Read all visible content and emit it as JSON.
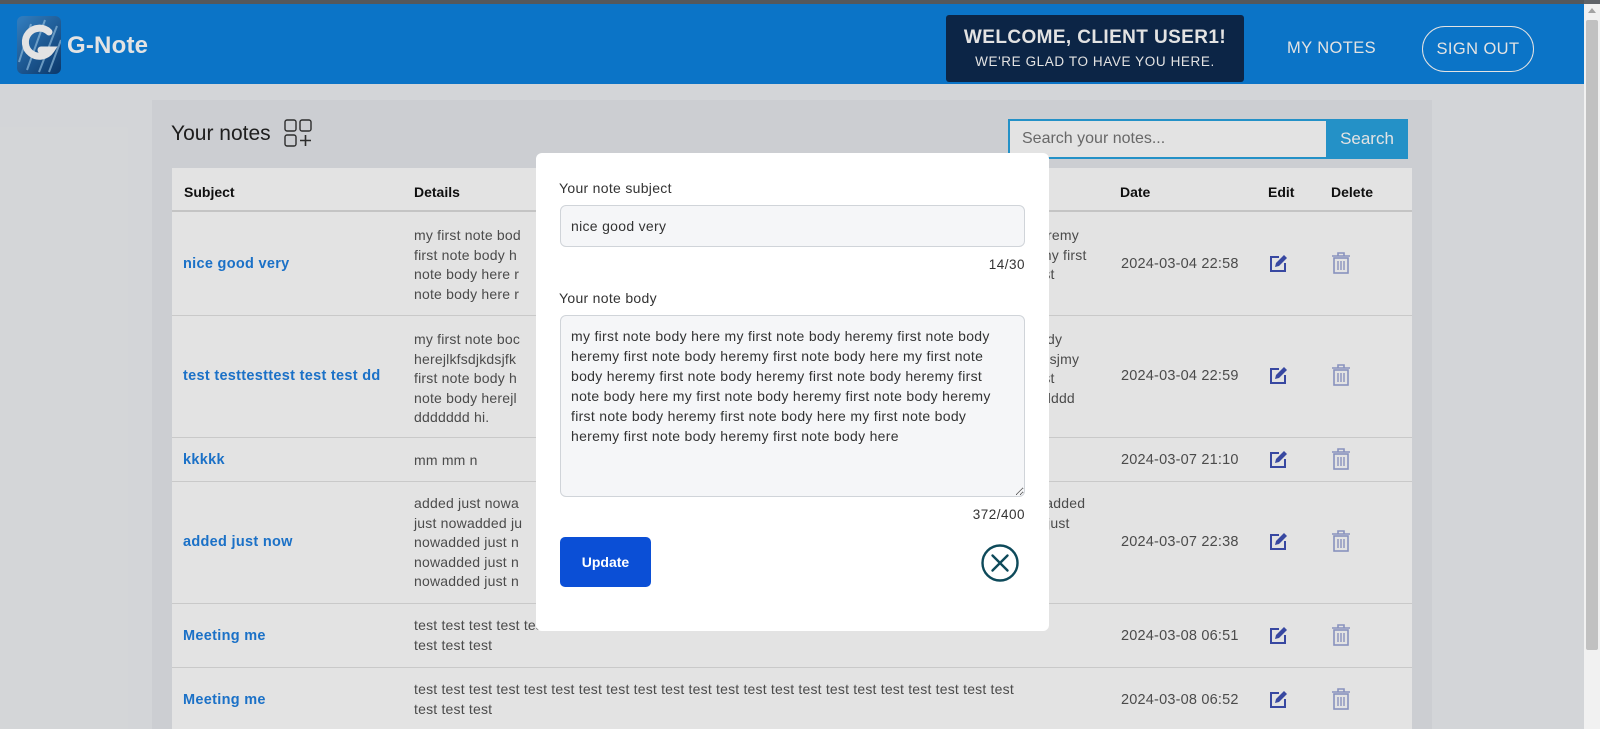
{
  "header": {
    "brand": "G-Note",
    "welcome_line1": "WELCOME, CLIENT USER1!",
    "welcome_line2": "WE'RE GLAD TO HAVE YOU HERE.",
    "nav_my_notes": "MY NOTES",
    "nav_sign_out": "SIGN OUT"
  },
  "panel": {
    "title": "Your notes",
    "search_placeholder": "Search your notes...",
    "search_button": "Search"
  },
  "table": {
    "columns": {
      "subject": "Subject",
      "details": "Details",
      "date": "Date",
      "edit": "Edit",
      "delete": "Delete"
    },
    "rows": [
      {
        "subject": "nice good very",
        "details_left": "my first note bod\nfirst note body h\nnote body here r\nnote body here r",
        "details_right": " heremy\nremy first\n first\n",
        "date": "2024-03-04 22:58"
      },
      {
        "subject": "test testtesttest test test dd",
        "details_left": "my first note boc\nherejlkfsdjkdsjfk\nfirst note body h\nnote body herejl\nddddddd hi.",
        "details_right": " body\njfkdsjmy\n first\ndddddd\n",
        "date": "2024-03-04 22:59"
      },
      {
        "subject": "kkkkk",
        "details_left": "mm mm n",
        "details_right": "",
        "date": "2024-03-07 21:10"
      },
      {
        "subject": "added just now",
        "details_left": "added just nowa\njust nowadded ju\nnowadded just n\nnowadded just n\nnowadded just n",
        "details_right": "owadded\ned just\nst\nst\n",
        "date": "2024-03-07 22:38"
      },
      {
        "subject": "Meeting me",
        "details_left": "test test test test test test test test test test test test test test test test test test test test test test\ntest test test",
        "details_right": "",
        "date": "2024-03-08 06:51"
      },
      {
        "subject": "Meeting me",
        "details_left": "test test test test test test test test test test test test test test test test test test test test test test\ntest test test",
        "details_right": "",
        "date": "2024-03-08 06:52"
      }
    ]
  },
  "modal": {
    "subject_label": "Your note subject",
    "subject_value": "nice good very",
    "subject_counter": "14/30",
    "body_label": "Your note body",
    "body_value": "my first note body here my first note body heremy first note body heremy first note body heremy first note body here my first note body heremy first note body heremy first note body heremy first note body here my first note body heremy first note body heremy first note body heremy first note body here my first note body heremy first note body heremy first note body here",
    "body_counter": "372/400",
    "update_button": "Update"
  },
  "colors": {
    "header_bg": "#0d83e0",
    "welcome_bg": "#0e2a4f",
    "link_blue": "#1f7fe0",
    "search_accent": "#29a3e0",
    "update_button": "#0b4fd6",
    "icon_blue": "#3f51b5"
  },
  "icons": {
    "logo": "g-note-logo",
    "add_note": "add-grid-icon",
    "edit": "edit-icon",
    "delete": "trash-icon",
    "close": "close-circle-icon"
  }
}
